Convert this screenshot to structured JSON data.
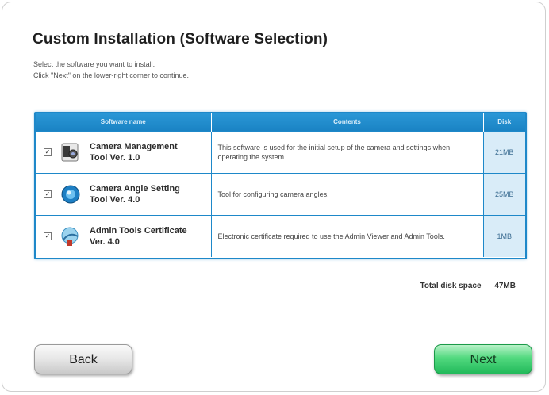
{
  "title": "Custom Installation (Software Selection)",
  "instructions": {
    "line1": "Select the software you want to install.",
    "line2": "Click \"Next\" on the lower-right corner to continue."
  },
  "table": {
    "headers": {
      "name": "Software name",
      "contents": "Contents",
      "disk": "Disk"
    },
    "rows": [
      {
        "checked": true,
        "checkmark": "✓",
        "icon": "camera-management-icon",
        "name_line1": "Camera Management",
        "name_line2": "Tool Ver. 1.0",
        "contents": "This software is used for the initial setup of the camera and settings when operating the system.",
        "disk": "21MB"
      },
      {
        "checked": true,
        "checkmark": "✓",
        "icon": "camera-angle-icon",
        "name_line1": "Camera Angle Setting",
        "name_line2": "Tool Ver. 4.0",
        "contents": "Tool for configuring camera angles.",
        "disk": "25MB"
      },
      {
        "checked": true,
        "checkmark": "✓",
        "icon": "certificate-icon",
        "name_line1": "Admin Tools Certificate",
        "name_line2": "Ver. 4.0",
        "contents": "Electronic certificate required to use the Admin Viewer and Admin Tools.",
        "disk": "1MB"
      }
    ]
  },
  "total": {
    "label": "Total disk space",
    "value": "47MB"
  },
  "buttons": {
    "back": "Back",
    "next": "Next"
  },
  "colors": {
    "table_border": "#1e88c9",
    "header_bg": "#2a97d6",
    "disk_bg": "#d9ecf8",
    "next_button": "#21b95a"
  }
}
